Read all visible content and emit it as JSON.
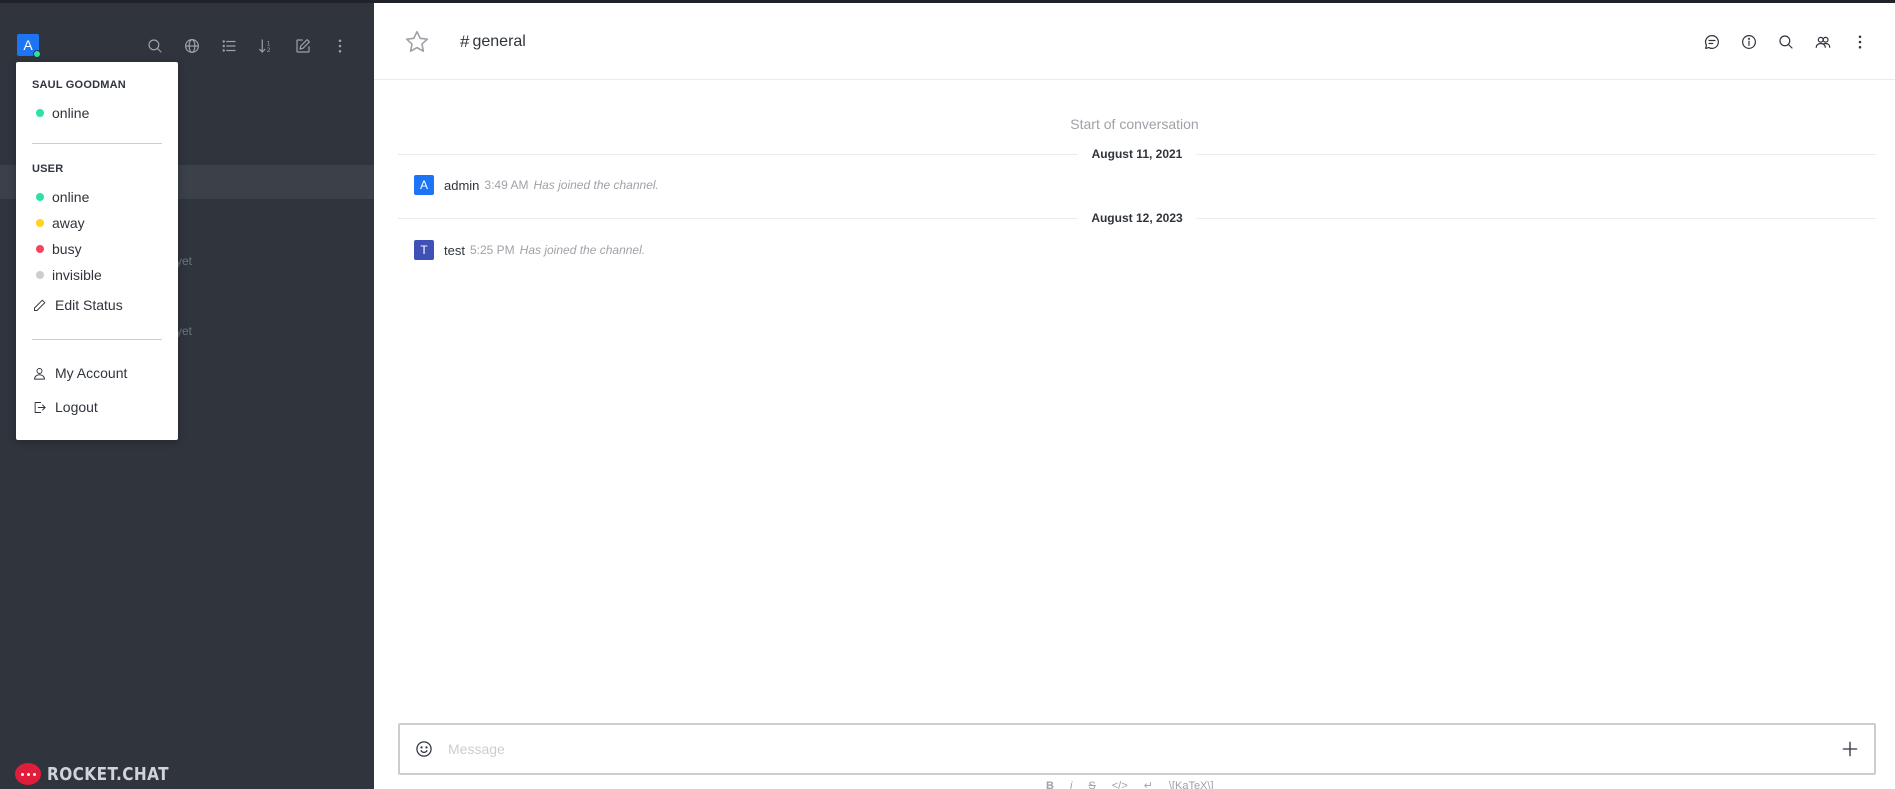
{
  "sidebar": {
    "avatar_letter": "A",
    "tools": [
      {
        "name": "search-icon"
      },
      {
        "name": "directory-icon"
      },
      {
        "name": "view-mode-icon"
      },
      {
        "name": "sort-icon"
      },
      {
        "name": "create-new-icon"
      },
      {
        "name": "kebab-menu-icon"
      }
    ],
    "hint_1": "yet",
    "hint_2": "yet",
    "logo_text": "ROCKET.CHAT"
  },
  "status_menu": {
    "user_name": "SAUL GOODMAN",
    "current_status": "online",
    "section_label": "USER",
    "statuses": [
      {
        "label": "online",
        "color": "#2de0a5"
      },
      {
        "label": "away",
        "color": "#ffd21f"
      },
      {
        "label": "busy",
        "color": "#f5455c"
      },
      {
        "label": "invisible",
        "color": "#cbced1"
      }
    ],
    "edit_status": "Edit Status",
    "my_account": "My Account",
    "logout": "Logout"
  },
  "room": {
    "hash": "#",
    "name": "general",
    "header_tools": [
      {
        "name": "threads-icon"
      },
      {
        "name": "info-icon"
      },
      {
        "name": "search-messages-icon"
      },
      {
        "name": "members-icon"
      },
      {
        "name": "kebab-menu-icon"
      }
    ]
  },
  "messages": {
    "start_label": "Start of conversation",
    "dates": [
      "August 11, 2021",
      "August 12, 2023"
    ],
    "items": [
      {
        "avatar": "A",
        "avatar_color": "#1d74f5",
        "user": "admin",
        "time": "3:49 AM",
        "text": "Has joined the channel."
      },
      {
        "avatar": "T",
        "avatar_color": "#3f51b5",
        "user": "test",
        "time": "5:25 PM",
        "text": "Has joined the channel."
      }
    ]
  },
  "composer": {
    "placeholder": "Message",
    "format_tools": [
      "B",
      "i",
      "S",
      "</>",
      "↵",
      "\\[KaTeX\\]"
    ]
  }
}
